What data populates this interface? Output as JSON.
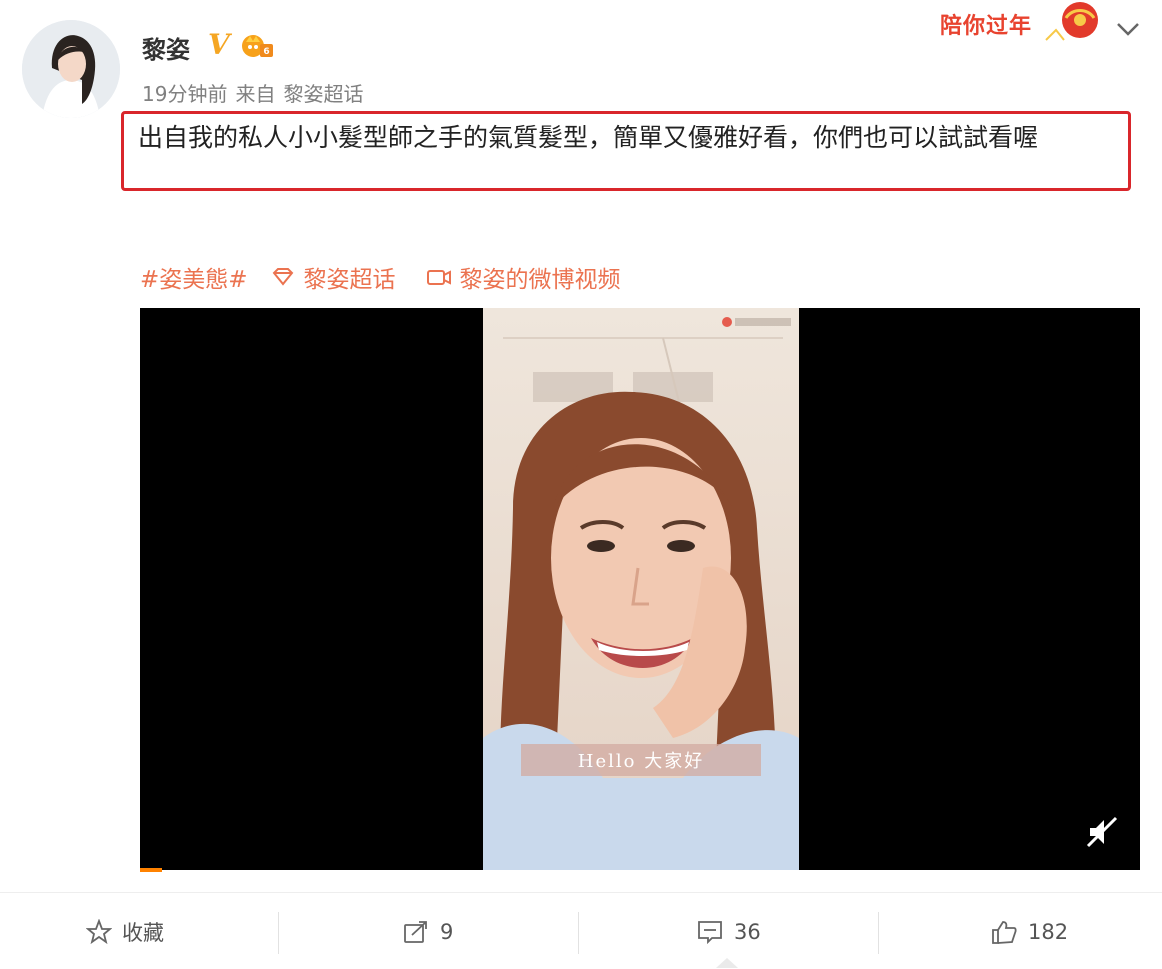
{
  "post": {
    "username": "黎姿",
    "verified_badge": "V",
    "time": "19分钟前",
    "source_prefix": "来自",
    "source": "黎姿超话",
    "text": "出自我的私人小小髮型師之手的氣質髮型，簡單又優雅好看，你們也可以試試看喔",
    "tags": [
      {
        "label": "#姿美態#",
        "icon": ""
      },
      {
        "label": "黎姿超话",
        "icon": "diamond-icon"
      },
      {
        "label": "黎姿的微博视频",
        "icon": "video-icon"
      }
    ],
    "promo_label": "陪你过年"
  },
  "video": {
    "caption": "Hello 大家好",
    "progress_percent": 2
  },
  "actions": {
    "favorite_label": "收藏",
    "repost_count": "9",
    "comment_count": "36",
    "like_count": "182"
  },
  "colors": {
    "accent": "#eb7350",
    "highlight_border": "#d9262b",
    "progress": "#ff8200"
  }
}
